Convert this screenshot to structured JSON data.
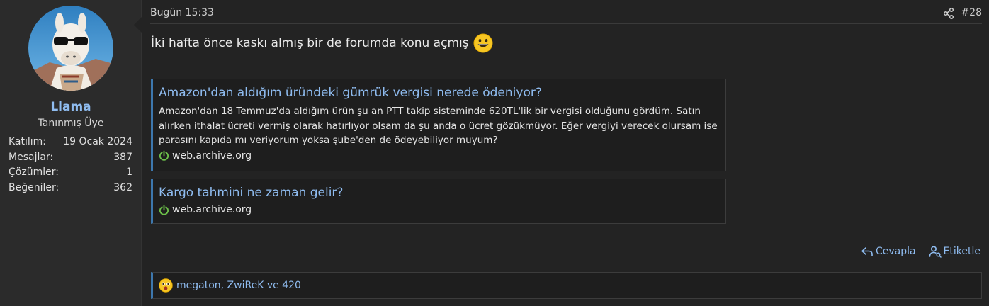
{
  "user": {
    "name": "Llama",
    "title": "Tanınmış Üye",
    "stats": [
      {
        "label": "Katılım:",
        "value": "19 Ocak 2024"
      },
      {
        "label": "Mesajlar:",
        "value": "387"
      },
      {
        "label": "Çözümler:",
        "value": "1"
      },
      {
        "label": "Beğeniler:",
        "value": "362"
      }
    ]
  },
  "post": {
    "date": "Bugün 15:33",
    "number": "#28",
    "text": "İki hafta önce kaskı almış bir de forumda konu açmış"
  },
  "embeds": [
    {
      "title": "Amazon'dan aldığım üründeki gümrük vergisi nerede ödeniyor?",
      "description": "Amazon'dan 18 Temmuz'da aldığım ürün şu an PTT takip sisteminde 620TL'lik bir vergisi olduğunu gördüm. Satın alırken ithalat ücreti vermiş olarak hatırlıyor olsam da şu anda o ücret gözükmüyor. Eğer vergiyi verecek olursam ise parasını kapıda mı veriyorum yoksa şube'den de ödeyebiliyor muyum?",
      "source": "web.archive.org"
    },
    {
      "title": "Kargo tahmini ne zaman gelir?",
      "source": "web.archive.org"
    }
  ],
  "actions": {
    "reply": "Cevapla",
    "tag": "Etiketle"
  },
  "reactions": {
    "text": "megaton, ZwiReK ve 420"
  },
  "colors": {
    "accent": "#8fbcf0",
    "embed_border": "#3d77ad",
    "source_icon": "#6cc04a"
  }
}
